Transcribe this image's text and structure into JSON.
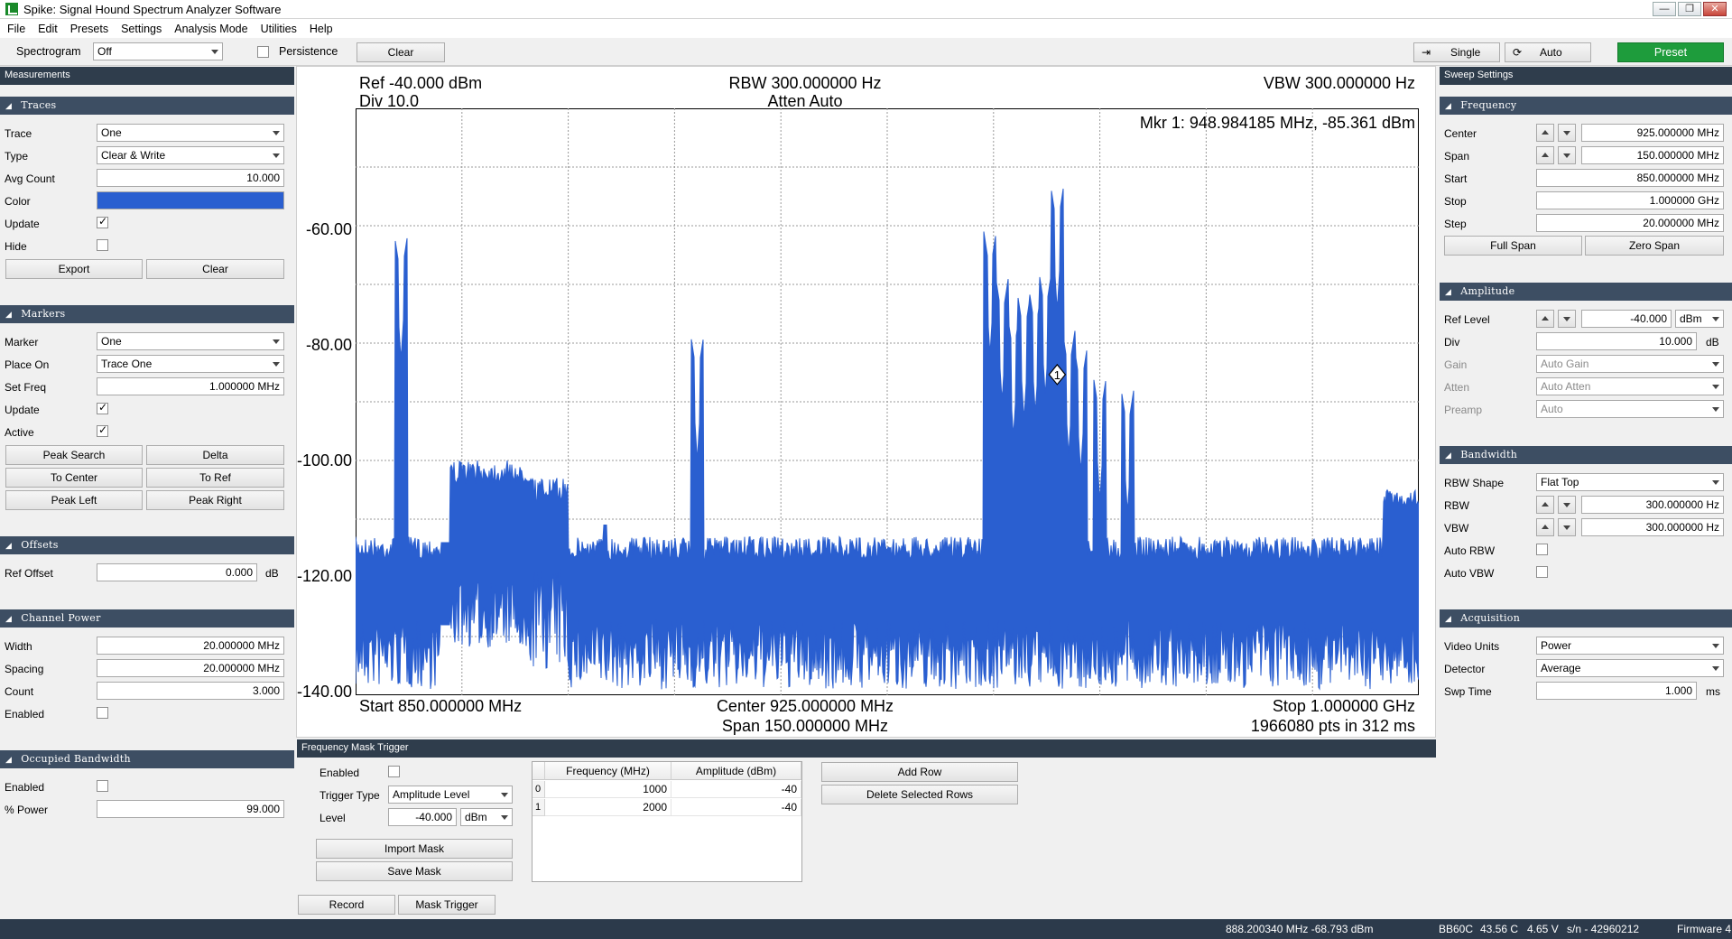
{
  "window": {
    "title": "Spike: Signal Hound Spectrum Analyzer Software",
    "buttons": [
      "—",
      "❐",
      "✕"
    ]
  },
  "menu": [
    "File",
    "Edit",
    "Presets",
    "Settings",
    "Analysis Mode",
    "Utilities",
    "Help"
  ],
  "toolbar": {
    "spectrogram_label": "Spectrogram",
    "spectrogram_value": "Off",
    "persistence_label": "Persistence",
    "clear_label": "Clear",
    "single_label": "Single",
    "auto_label": "Auto",
    "preset_label": "Preset",
    "preset_color": "#1e9c3c"
  },
  "left": {
    "title": "Measurements",
    "traces": {
      "header": "Traces",
      "trace_label": "Trace",
      "trace_value": "One",
      "type_label": "Type",
      "type_value": "Clear & Write",
      "avg_label": "Avg Count",
      "avg_value": "10.000",
      "color_label": "Color",
      "color_value": "#2a5fd0",
      "update_label": "Update",
      "hide_label": "Hide",
      "export_label": "Export",
      "clear_label": "Clear"
    },
    "markers": {
      "header": "Markers",
      "marker_label": "Marker",
      "marker_value": "One",
      "place_label": "Place On",
      "place_value": "Trace One",
      "setfreq_label": "Set Freq",
      "setfreq_value": "1.000000 MHz",
      "update_label": "Update",
      "active_label": "Active",
      "peak_search": "Peak Search",
      "delta": "Delta",
      "to_center": "To Center",
      "to_ref": "To Ref",
      "peak_left": "Peak Left",
      "peak_right": "Peak Right"
    },
    "offsets": {
      "header": "Offsets",
      "ref_label": "Ref Offset",
      "ref_value": "0.000",
      "ref_unit": "dB"
    },
    "channel": {
      "header": "Channel Power",
      "width_label": "Width",
      "width_value": "20.000000 MHz",
      "spacing_label": "Spacing",
      "spacing_value": "20.000000 MHz",
      "count_label": "Count",
      "count_value": "3.000",
      "enabled_label": "Enabled"
    },
    "occupied": {
      "header": "Occupied Bandwidth",
      "enabled_label": "Enabled",
      "power_label": "% Power",
      "power_value": "99.000"
    }
  },
  "plot": {
    "ref": "Ref -40.000 dBm",
    "div": "Div 10.0",
    "rbw": "RBW 300.000000 Hz",
    "atten": "Atten Auto",
    "vbw": "VBW 300.000000 Hz",
    "marker_readout": "Mkr 1: 948.984185 MHz, -85.361 dBm",
    "marker_id": "1",
    "y_ticks": [
      "-60.00",
      "-80.00",
      "-100.00",
      "-120.00",
      "-140.00"
    ],
    "start": "Start 850.000000 MHz",
    "center": "Center 925.000000 MHz",
    "span": "Span 150.000000 MHz",
    "stop": "Stop 1.000000 GHz",
    "points": "1966080 pts in 312 ms",
    "trace_color": "#2a5fd0"
  },
  "mask": {
    "title": "Frequency Mask Trigger",
    "enabled_label": "Enabled",
    "trigger_label": "Trigger Type",
    "trigger_value": "Amplitude Level",
    "level_label": "Level",
    "level_value": "-40.000",
    "level_unit": "dBm",
    "import_label": "Import Mask",
    "save_label": "Save Mask",
    "col_freq": "Frequency (MHz)",
    "col_amp": "Amplitude (dBm)",
    "rows": [
      {
        "idx": "0",
        "freq": "1000",
        "amp": "-40"
      },
      {
        "idx": "1",
        "freq": "2000",
        "amp": "-40"
      }
    ],
    "add_row": "Add Row",
    "delete_rows": "Delete Selected Rows",
    "record_tab": "Record",
    "mask_tab": "Mask Trigger"
  },
  "right": {
    "title": "Sweep Settings",
    "frequency": {
      "header": "Frequency",
      "center_label": "Center",
      "center_value": "925.000000 MHz",
      "span_label": "Span",
      "span_value": "150.000000 MHz",
      "start_label": "Start",
      "start_value": "850.000000 MHz",
      "stop_label": "Stop",
      "stop_value": "1.000000 GHz",
      "step_label": "Step",
      "step_value": "20.000000 MHz",
      "full_span": "Full Span",
      "zero_span": "Zero Span"
    },
    "amplitude": {
      "header": "Amplitude",
      "ref_label": "Ref Level",
      "ref_value": "-40.000",
      "ref_unit": "dBm",
      "div_label": "Div",
      "div_value": "10.000",
      "div_unit": "dB",
      "gain_label": "Gain",
      "gain_value": "Auto Gain",
      "atten_label": "Atten",
      "atten_value": "Auto Atten",
      "preamp_label": "Preamp",
      "preamp_value": "Auto"
    },
    "bandwidth": {
      "header": "Bandwidth",
      "shape_label": "RBW Shape",
      "shape_value": "Flat Top",
      "rbw_label": "RBW",
      "rbw_value": "300.000000 Hz",
      "vbw_label": "VBW",
      "vbw_value": "300.000000 Hz",
      "auto_rbw_label": "Auto RBW",
      "auto_vbw_label": "Auto VBW"
    },
    "acquisition": {
      "header": "Acquisition",
      "units_label": "Video Units",
      "units_value": "Power",
      "detector_label": "Detector",
      "detector_value": "Average",
      "swp_label": "Swp Time",
      "swp_value": "1.000",
      "swp_unit": "ms"
    }
  },
  "status": {
    "cursor": "888.200340 MHz -68.793 dBm",
    "device": "BB60C",
    "temp": "43.56 C",
    "volt": "4.65 V",
    "serial": "s/n - 42960212",
    "firmware": "Firmware 4"
  }
}
